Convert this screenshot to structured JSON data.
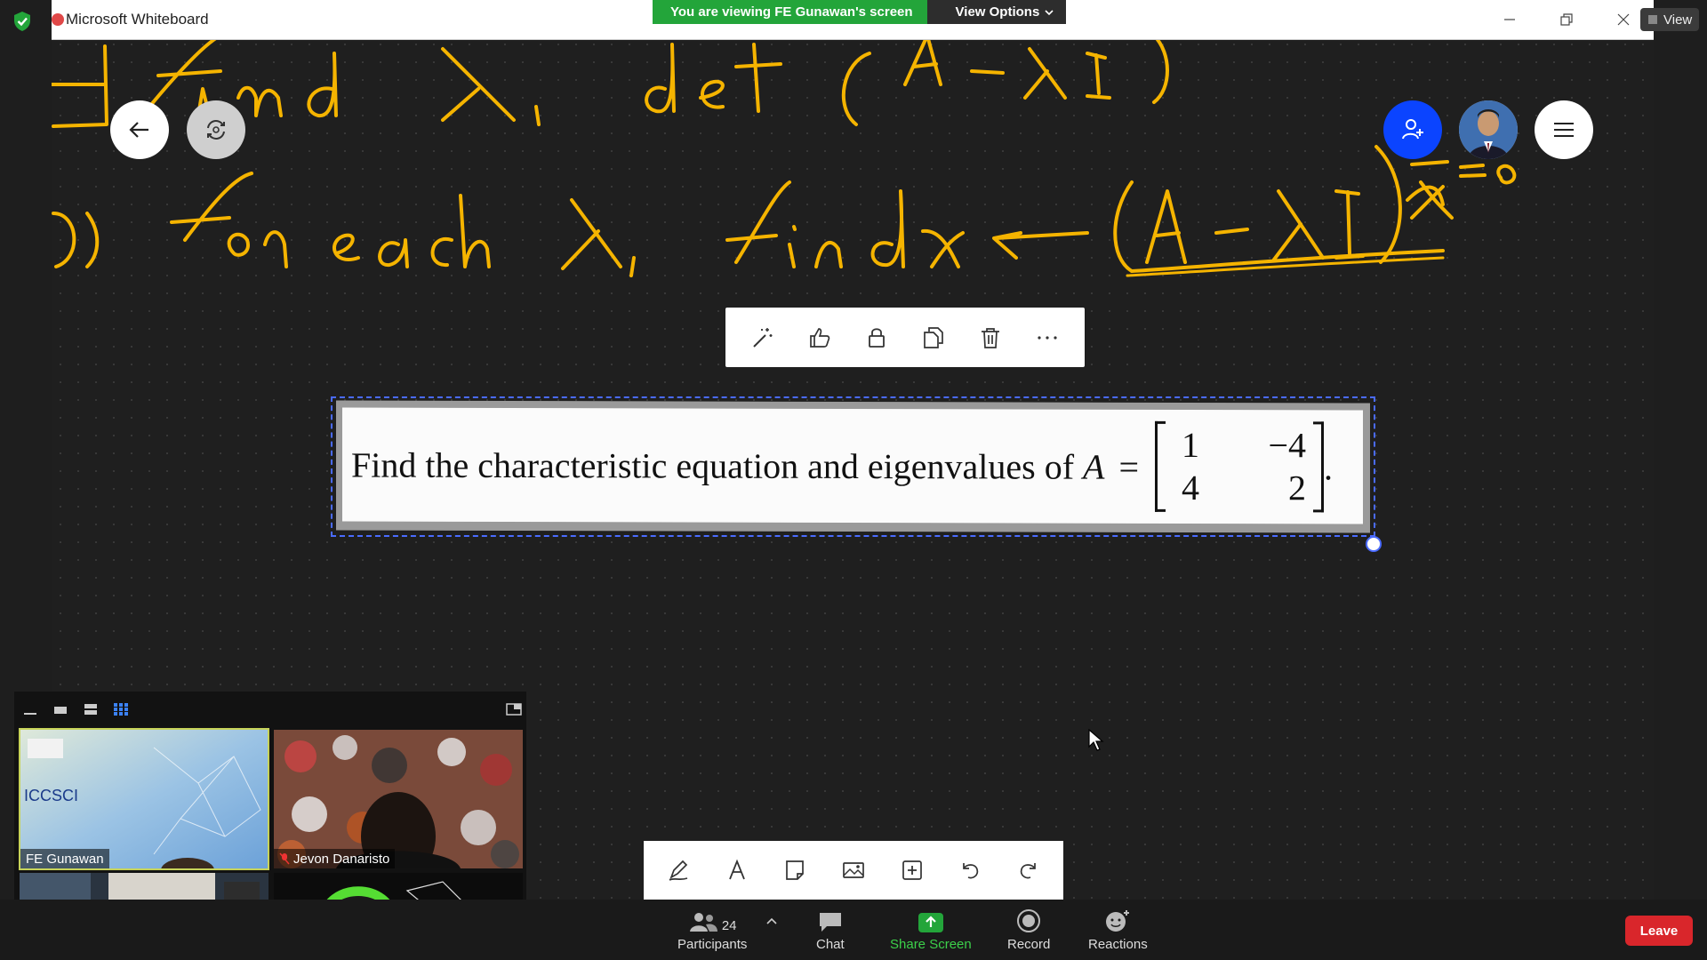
{
  "app": {
    "title": "Microsoft Whiteboard"
  },
  "share_banner": {
    "message": "You are viewing FE Gunawan's screen",
    "options_label": "View Options"
  },
  "view_button": "View",
  "board": {
    "pasted_problem": {
      "prefix": "Find the characteristic equation and eigenvalues of",
      "var": "A",
      "equals": "=",
      "matrix": [
        [
          "1",
          "−4"
        ],
        [
          "4",
          "2"
        ]
      ],
      "suffix": "."
    }
  },
  "selection_toolbar": [
    "magic-wand",
    "thumbs-up",
    "lock",
    "duplicate",
    "delete",
    "more"
  ],
  "draw_toolbar": [
    "pen",
    "text",
    "sticky-note",
    "image",
    "insert",
    "undo",
    "redo"
  ],
  "participants_panel": {
    "tiles": [
      {
        "name": "FE Gunawan",
        "muted": false,
        "active": true
      },
      {
        "name": "Jevon Danaristo",
        "muted": true,
        "active": false
      },
      {
        "name": "",
        "muted": false,
        "active": false
      },
      {
        "name": "",
        "muted": false,
        "active": false
      }
    ]
  },
  "controls": {
    "participants_label": "Participants",
    "participants_count": "24",
    "chat_label": "Chat",
    "share_label": "Share Screen",
    "record_label": "Record",
    "reactions_label": "Reactions",
    "leave_label": "Leave"
  },
  "colors": {
    "ink": "#f5b400",
    "share_green": "#23a53a",
    "leave_red": "#d9262b",
    "accent_blue": "#0b44ff"
  }
}
